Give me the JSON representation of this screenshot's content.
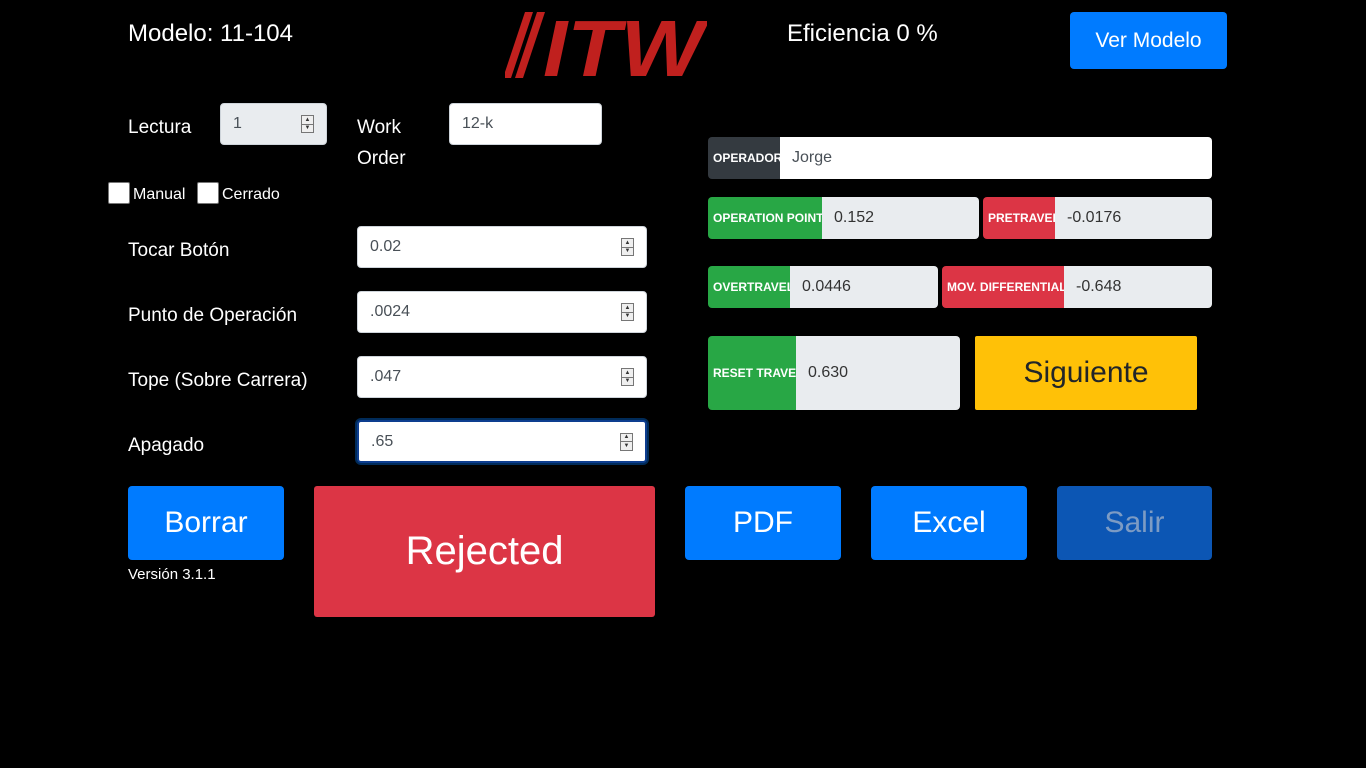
{
  "header": {
    "modelo": "Modelo: 11-104",
    "logo_text": "ITW",
    "eficiencia": "Eficiencia 0 %",
    "ver_modelo": "Ver Modelo"
  },
  "form": {
    "lectura_label": "Lectura",
    "lectura_value": "1",
    "work_order_label_1": "Work",
    "work_order_label_2": "Order",
    "work_order_value": "12-k",
    "manual_label": "Manual",
    "cerrado_label": "Cerrado",
    "tocar_boton_label": "Tocar Botón",
    "tocar_boton_value": "0.02",
    "punto_operacion_label": "Punto de Operación",
    "punto_operacion_value": ".0024",
    "tope_label": "Tope (Sobre Carrera)",
    "tope_value": ".047",
    "apagado_label": "Apagado",
    "apagado_value": ".65"
  },
  "results": {
    "operador_label": "OPERADOR",
    "operador_value": "Jorge",
    "operation_point_label": "OPERATION POINT",
    "operation_point_value": "0.152",
    "pretravel_label": "PRETRAVEL",
    "pretravel_value": "-0.0176",
    "overtravel_label": "OVERTRAVEL",
    "overtravel_value": "0.0446",
    "mov_differential_label": "MOV. DIFFERENTIAL",
    "mov_differential_value": "-0.648",
    "reset_travel_label": "RESET TRAVEL",
    "reset_travel_value": "0.630",
    "siguiente": "Siguiente"
  },
  "actions": {
    "borrar": "Borrar",
    "version": "Versión 3.1.1",
    "status": "Rejected",
    "pdf": "PDF",
    "excel": "Excel",
    "salir": "Salir"
  },
  "colors": {
    "primary": "#007bff",
    "danger": "#dc3545",
    "success": "#28a745",
    "warning": "#ffc107",
    "logo_red": "#c0201e"
  }
}
